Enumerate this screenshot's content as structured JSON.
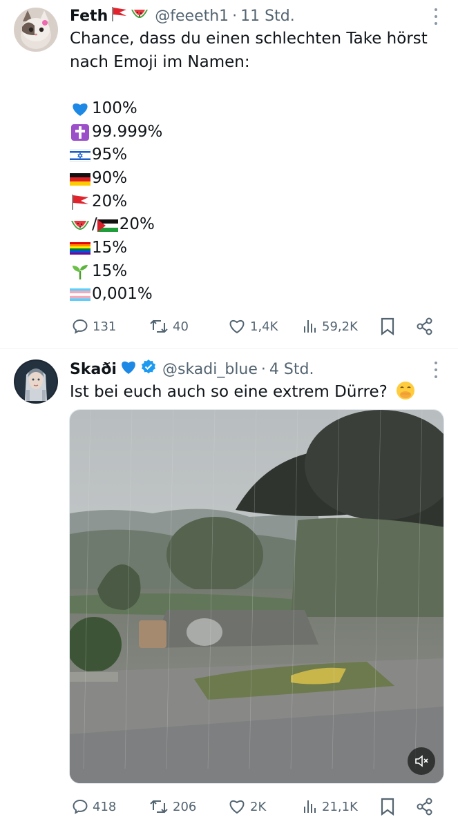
{
  "tweet1": {
    "name": "Feth",
    "name_emojis": [
      "red-flag",
      "watermelon"
    ],
    "handle": "@feeeth1",
    "separator": "·",
    "time": "11 Std.",
    "text": "Chance, dass du einen schlechten Take hörst nach Emoji im Namen:",
    "rows": [
      {
        "icon": "blue-heart-icon",
        "value": "100%"
      },
      {
        "icon": "latin-cross-icon",
        "value": "99.999%"
      },
      {
        "icon": "israel-flag-icon",
        "value": "95%"
      },
      {
        "icon": "germany-flag-icon",
        "value": "90%"
      },
      {
        "icon": "red-flag-icon",
        "value": "20%"
      },
      {
        "icon": "watermelon-palestine-flag-icon",
        "sep": "/",
        "value": "20%"
      },
      {
        "icon": "rainbow-flag-icon",
        "value": "15%"
      },
      {
        "icon": "seedling-icon",
        "value": "15%"
      },
      {
        "icon": "transgender-flag-icon",
        "value": "0,001%"
      }
    ],
    "actions": {
      "replies": "131",
      "reposts": "40",
      "likes": "1,4K",
      "views": "59,2K"
    }
  },
  "tweet2": {
    "name": "Skaði",
    "name_emojis": [
      "blue-heart"
    ],
    "verified": true,
    "handle": "@skadi_blue",
    "separator": "·",
    "time": "4 Std.",
    "text": "Ist bei euch auch so eine extrem Dürre?",
    "text_emoji": "face-with-hand-over-mouth",
    "media": {
      "type": "video",
      "description_icon": "garden-rain-video",
      "muted": true
    },
    "actions": {
      "replies": "418",
      "reposts": "206",
      "likes": "2K",
      "views": "21,1K"
    }
  },
  "colors": {
    "text": "#0f1419",
    "secondary": "#536471",
    "verified": "#1d9bf0",
    "divider": "#eff3f4"
  }
}
